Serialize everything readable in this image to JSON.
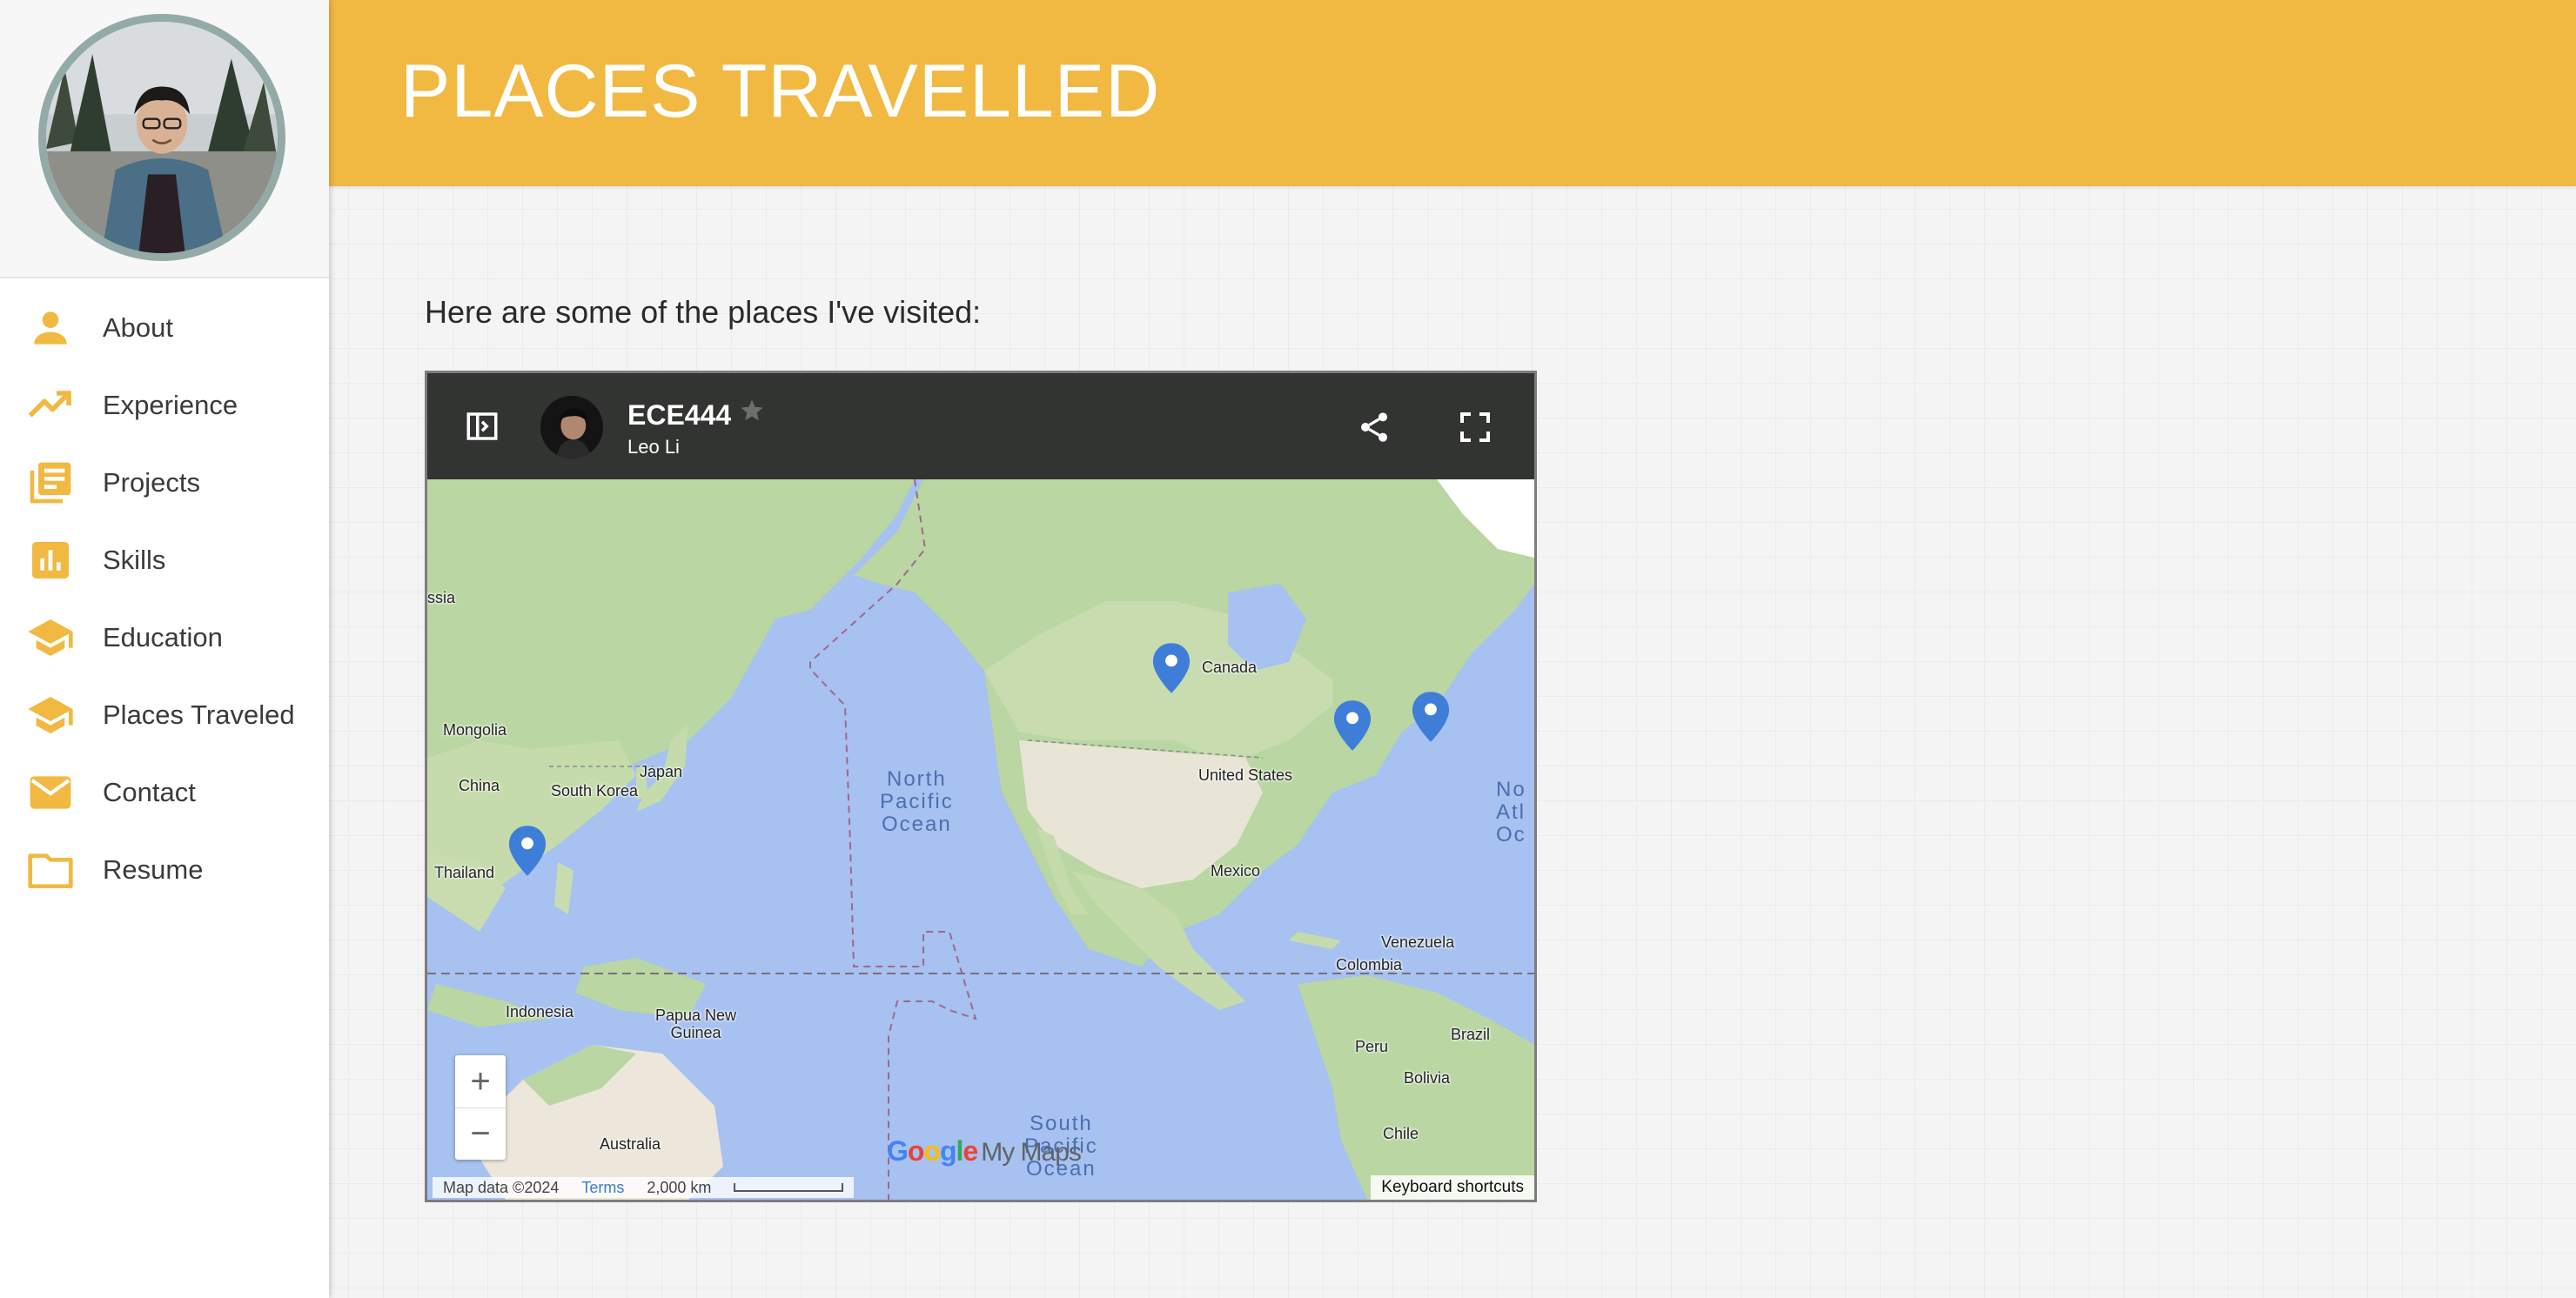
{
  "header": {
    "title": "PLACES TRAVELLED"
  },
  "sidebar": {
    "items": [
      {
        "label": "About",
        "icon": "person-icon"
      },
      {
        "label": "Experience",
        "icon": "trending-up-icon"
      },
      {
        "label": "Projects",
        "icon": "library-books-icon"
      },
      {
        "label": "Skills",
        "icon": "bar-chart-icon"
      },
      {
        "label": "Education",
        "icon": "graduation-cap-icon"
      },
      {
        "label": "Places Traveled",
        "icon": "graduation-cap-icon"
      },
      {
        "label": "Contact",
        "icon": "mail-icon"
      },
      {
        "label": "Resume",
        "icon": "folder-icon"
      }
    ]
  },
  "main": {
    "intro": "Here are some of the places I've visited:"
  },
  "map": {
    "title": "ECE444",
    "owner": "Leo Li",
    "labels": {
      "canada": "Canada",
      "united_states": "United States",
      "mexico": "Mexico",
      "mongolia": "Mongolia",
      "china": "China",
      "japan": "Japan",
      "south_korea": "South Korea",
      "thailand": "Thailand",
      "indonesia": "Indonesia",
      "png": "Papua New\nGuinea",
      "australia": "Australia",
      "venezuela": "Venezuela",
      "colombia": "Colombia",
      "peru": "Peru",
      "brazil": "Brazil",
      "bolivia": "Bolivia",
      "chile": "Chile",
      "russia_partial": "ssia",
      "north_pacific": "North\nPacific\nOcean",
      "south_pacific": "South\nPacific\nOcean",
      "north_atlantic_partial": "No\nAtl\nOc"
    },
    "zoom_in": "+",
    "zoom_out": "−",
    "logo_google": "Google",
    "logo_mymaps": "My Maps",
    "attribution": "Map data ©2024",
    "terms": "Terms",
    "scale": "2,000 km",
    "keyboard_shortcuts": "Keyboard shortcuts"
  },
  "colors": {
    "accent": "#f1b941",
    "header_text": "#ffffff",
    "map_bar": "#323431",
    "ocean": "#a7c1f0",
    "pin": "#3f7ed8"
  }
}
